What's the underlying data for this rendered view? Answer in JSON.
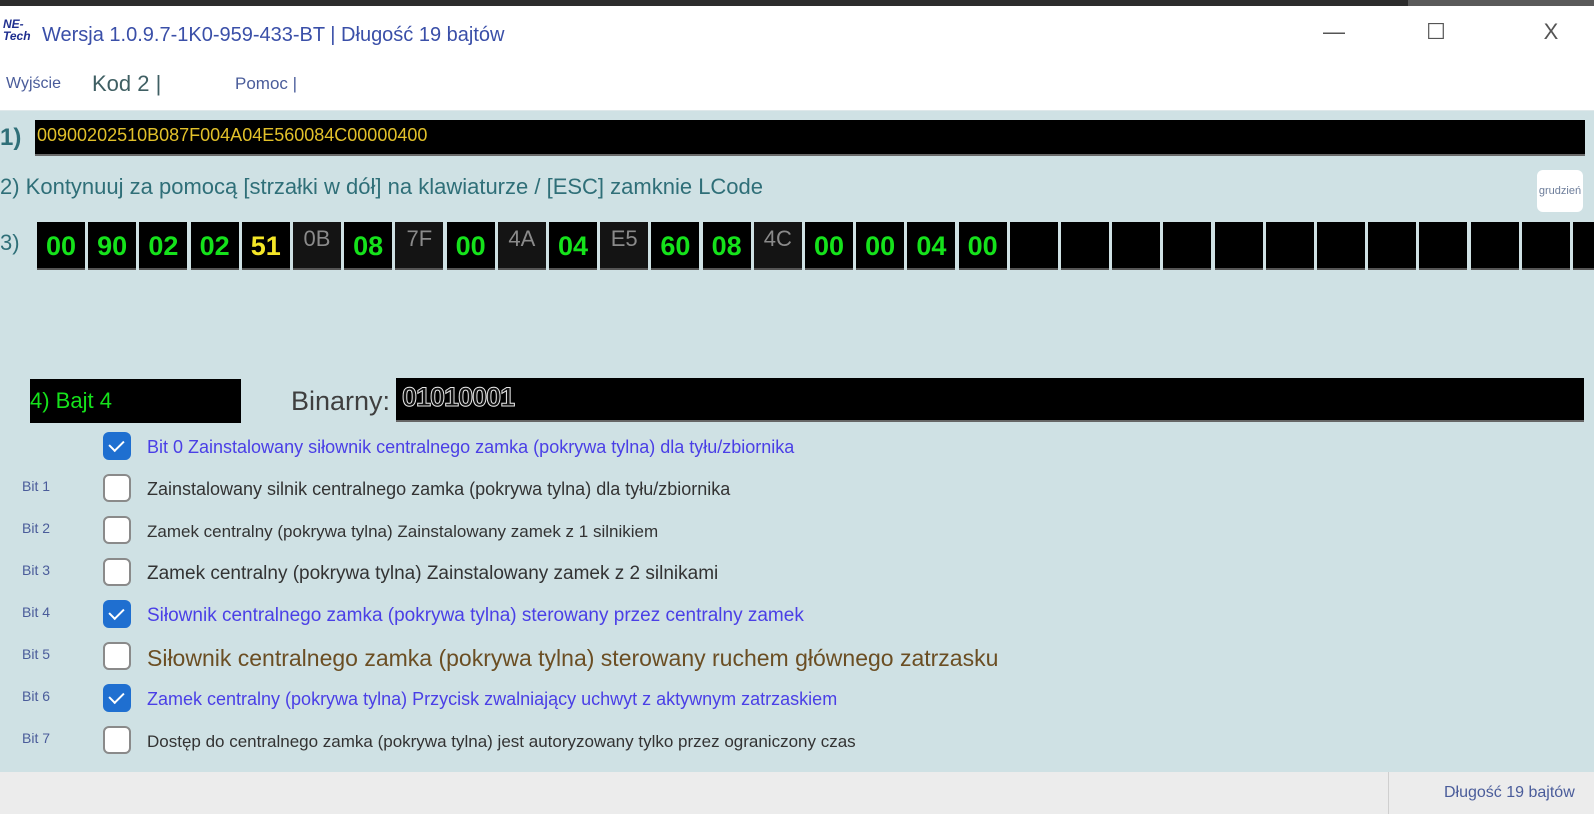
{
  "title": "Wersja 1.0.9.7-1K0-959-433-BT | Długość 19 bajtów",
  "logo": {
    "line1": "NE-",
    "line2": "Tech"
  },
  "window_controls": {
    "minimize": "—",
    "maximize": "☐",
    "close": "X"
  },
  "menu": {
    "exit": "Wyjście",
    "code": "Kod 2 |",
    "help": "Pomoc |"
  },
  "row1": {
    "label": "1)",
    "code": "00900202510B087F004A04E560084C00000400"
  },
  "row2": {
    "hint": "2) Kontynuuj za pomocą [strzałki w dół] na klawiaturze / [ESC] zamknie LCode",
    "month_button": "grudzień"
  },
  "row3": {
    "label": "3)",
    "bytes": [
      {
        "v": "00",
        "s": "green"
      },
      {
        "v": "90",
        "s": "green"
      },
      {
        "v": "02",
        "s": "green"
      },
      {
        "v": "02",
        "s": "green"
      },
      {
        "v": "51",
        "s": "yellow"
      },
      {
        "v": "0B",
        "s": "gray"
      },
      {
        "v": "08",
        "s": "green"
      },
      {
        "v": "7F",
        "s": "gray"
      },
      {
        "v": "00",
        "s": "green"
      },
      {
        "v": "4A",
        "s": "gray"
      },
      {
        "v": "04",
        "s": "green"
      },
      {
        "v": "E5",
        "s": "gray"
      },
      {
        "v": "60",
        "s": "green"
      },
      {
        "v": "08",
        "s": "green"
      },
      {
        "v": "4C",
        "s": "gray"
      },
      {
        "v": "00",
        "s": "green"
      },
      {
        "v": "00",
        "s": "green"
      },
      {
        "v": "04",
        "s": "green"
      },
      {
        "v": "00",
        "s": "green"
      },
      {
        "v": "",
        "s": "empty"
      },
      {
        "v": "",
        "s": "empty"
      },
      {
        "v": "",
        "s": "empty"
      },
      {
        "v": "",
        "s": "empty"
      },
      {
        "v": "",
        "s": "empty"
      },
      {
        "v": "",
        "s": "empty"
      },
      {
        "v": "",
        "s": "empty"
      },
      {
        "v": "",
        "s": "empty"
      },
      {
        "v": "",
        "s": "empty"
      },
      {
        "v": "",
        "s": "empty"
      },
      {
        "v": "",
        "s": "empty"
      },
      {
        "v": "",
        "s": "empty"
      }
    ]
  },
  "row4": {
    "byte_label": "4) Bajt 4",
    "binary_label": "Binarny:",
    "binary_value": "01010001"
  },
  "bits": [
    {
      "label": "",
      "checked": true,
      "text": "Bit 0 Zainstalowany siłownik centralnego zamka (pokrywa tylna) dla tyłu/zbiornika",
      "color": "#4a3fe6",
      "size": 18
    },
    {
      "label": "Bit 1",
      "checked": false,
      "text": "Zainstalowany silnik centralnego zamka (pokrywa tylna) dla tyłu/zbiornika",
      "color": "#333333",
      "size": 18
    },
    {
      "label": "Bit 2",
      "checked": false,
      "text": "Zamek centralny (pokrywa tylna) Zainstalowany zamek z 1 silnikiem",
      "color": "#333333",
      "size": 17
    },
    {
      "label": "Bit 3",
      "checked": false,
      "text": "Zamek centralny (pokrywa tylna) Zainstalowany zamek z 2 silnikami",
      "color": "#333333",
      "size": 19
    },
    {
      "label": "Bit 4",
      "checked": true,
      "text": "Siłownik centralnego zamka (pokrywa tylna) sterowany przez centralny zamek",
      "color": "#4a3fe6",
      "size": 19
    },
    {
      "label": "Bit 5",
      "checked": false,
      "text": "Siłownik centralnego zamka (pokrywa tylna) sterowany ruchem głównego zatrzasku",
      "color": "#6b4e23",
      "size": 23
    },
    {
      "label": "Bit 6",
      "checked": true,
      "text": "Zamek centralny (pokrywa tylna) Przycisk zwalniający uchwyt z aktywnym zatrzaskiem",
      "color": "#4a3fe6",
      "size": 18
    },
    {
      "label": "Bit 7",
      "checked": false,
      "text": "Dostęp do centralnego zamka (pokrywa tylna) jest autoryzowany tylko przez ograniczony czas",
      "color": "#333333",
      "size": 17
    }
  ],
  "status": {
    "length": "Długość 19 bajtów"
  }
}
